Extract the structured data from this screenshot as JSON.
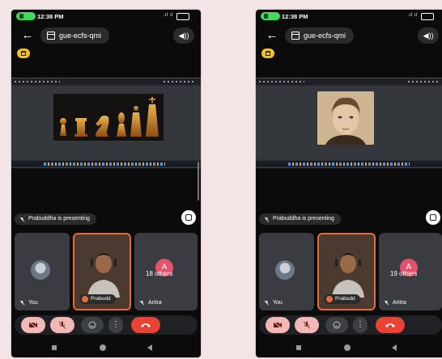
{
  "phones": [
    {
      "status": {
        "time": "12:38 PM",
        "signal": "📶",
        "battery": ""
      },
      "meeting_code": "gue-ecfs-qmi",
      "presenting": "Prabuddha is presenting",
      "shared_content": "chess-pieces-slide",
      "tiles": {
        "you": "You",
        "presenter": "Prabudd",
        "others_count": "18 others",
        "others_avatar": "A",
        "others_name": "Aritra"
      }
    },
    {
      "status": {
        "time": "12:38 PM",
        "signal": "📶",
        "battery": ""
      },
      "meeting_code": "gue-ecfs-qmi",
      "presenting": "Prabuddha is presenting",
      "shared_content": "portrait-slide",
      "tiles": {
        "you": "You",
        "presenter": "Prabudd",
        "others_count": "19 others",
        "others_avatar": "A",
        "others_name": "Aritra"
      }
    }
  ],
  "colors": {
    "background": "#f3e4e6",
    "call_pill": "#3ddc5a",
    "info_chip": "#f7c21c",
    "control_off": "#f2b8b5",
    "hang_up": "#ea4335",
    "speaking": "#e66a3a",
    "avatar_a": "#e5516b"
  },
  "icons": [
    "back-arrow-icon",
    "calendar-icon",
    "speaker-icon",
    "info-icon",
    "mic-off-icon",
    "fullscreen-icon",
    "camera-off-icon",
    "emoji-icon",
    "more-icon",
    "hang-up-icon"
  ]
}
